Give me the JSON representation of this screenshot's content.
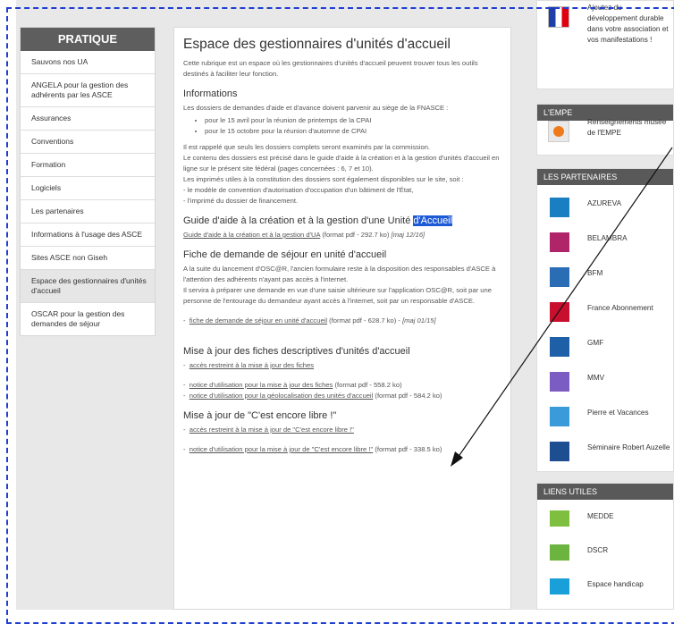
{
  "sidebar": {
    "title": "PRATIQUE",
    "items": [
      {
        "label": "Sauvons nos UA"
      },
      {
        "label": "ANGELA pour la gestion des adhérents par les ASCE"
      },
      {
        "label": "Assurances"
      },
      {
        "label": "Conventions"
      },
      {
        "label": "Formation"
      },
      {
        "label": "Logiciels"
      },
      {
        "label": "Les partenaires"
      },
      {
        "label": "Informations à l'usage des ASCE"
      },
      {
        "label": "Sites ASCE non Giseh"
      },
      {
        "label": "Espace des gestionnaires d'unités d'accueil"
      },
      {
        "label": "OSCAR pour la gestion des demandes de séjour"
      }
    ]
  },
  "main": {
    "title": "Espace des gestionnaires d'unités d'accueil",
    "intro": "Cette rubrique est un espace où les gestionnaires d'unités d'accueil peuvent trouver tous les outils destinés à faciliter leur fonction.",
    "info_title": "Informations",
    "info_p1": "Les dossiers de demandes d'aide et d'avance doivent parvenir au siège de la FNASCE :",
    "info_bullets": [
      "pour le 15 avril pour la réunion de printemps de la CPAI",
      "pour le 15 octobre pour la réunion d'automne de CPAI"
    ],
    "info_p2": "Il est rappelé que seuls les dossiers complets seront examinés par la commission.",
    "info_p3": "Le contenu des dossiers est précisé dans le guide d'aide à la création et à la gestion d'unités d'accueil en ligne sur le présent site fédéral (pages concernées : 6, 7 et 10).",
    "info_p4": "Les imprimés utiles à la constitution des dossiers sont également disponibles sur le site, soit :",
    "info_p5": "- le modèle de convention d'autorisation d'occupation d'un bâtiment de l'État,",
    "info_p6": "- l'imprimé du dossier de financement.",
    "guide_title": "Guide d'aide à la création et à la gestion d'une Unité",
    "guide_title_hl": "d'Accueil",
    "guide_link": "Guide d'aide à la création et à la gestion d'UA",
    "guide_meta": "(format pdf - 292.7 ko)",
    "guide_date": "[maj 12/16]",
    "fiche_title": "Fiche de demande de séjour en unité d'accueil",
    "fiche_p1": "A la suite du lancement d'OSC@R, l'ancien formulaire reste à la disposition des responsables d'ASCE à l'attention des adhérents n'ayant pas accès à l'internet.",
    "fiche_p2": "Il servira à préparer une demande en vue d'une saisie ultérieure sur l'application OSC@R, soit par une personne de l'entourage du demandeur ayant accès à l'internet, soit par un responsable d'ASCE.",
    "fiche_link": "fiche de demande de séjour en unité d'accueil",
    "fiche_meta": "(format pdf - 628.7 ko) -",
    "fiche_date": "[maj 01/15]",
    "maj_title": "Mise à jour des fiches descriptives d'unités d'accueil",
    "maj_link1": "accès restreint à la mise à jour des fiches",
    "maj_link2": "notice d'utilisation pour la mise à jour des fiches",
    "maj_meta2": "(format pdf - 558.2 ko)",
    "maj_link3": "notice d'utilisation pour la géolocalisation des unités d'accueil",
    "maj_meta3": "(format pdf - 584.2 ko)",
    "libre_title": "Mise à jour de \"C'est encore libre !\"",
    "libre_link1": "accès restreint à la mise à jour de \"C'est encore libre !\"",
    "libre_link2": "notice d'utilisation pour la mise à jour de \"C'est encore libre !\"",
    "libre_meta2": "(format pdf - 338.5 ko)"
  },
  "right": {
    "top_text": "Ajoutez du développement durable dans votre association et vos manifestations !",
    "empe_title": "L'EMPE",
    "empe_text": "Renseignements musée de l'EMPE",
    "partners_title": "LES PARTENAIRES",
    "partners": [
      {
        "name": "AZUREVA",
        "color": "#1a7fc0"
      },
      {
        "name": "BELAMBRA",
        "color": "#b0246a"
      },
      {
        "name": "BFM",
        "color": "#2a6db5"
      },
      {
        "name": "France Abonnement",
        "color": "#c8102e"
      },
      {
        "name": "GMF",
        "color": "#1f5fa8"
      },
      {
        "name": "MMV",
        "color": "#7a5cc2"
      },
      {
        "name": "Pierre et Vacances",
        "color": "#3b9ad9"
      },
      {
        "name": "Séminaire Robert Auzelle",
        "color": "#1d4e92"
      }
    ],
    "liens_title": "LIENS UTILES",
    "liens": [
      {
        "name": "MEDDE",
        "color": "#7fbf3f"
      },
      {
        "name": "DSCR",
        "color": "#6db33f"
      },
      {
        "name": "Espace handicap",
        "color": "#1aa0d8"
      }
    ]
  }
}
